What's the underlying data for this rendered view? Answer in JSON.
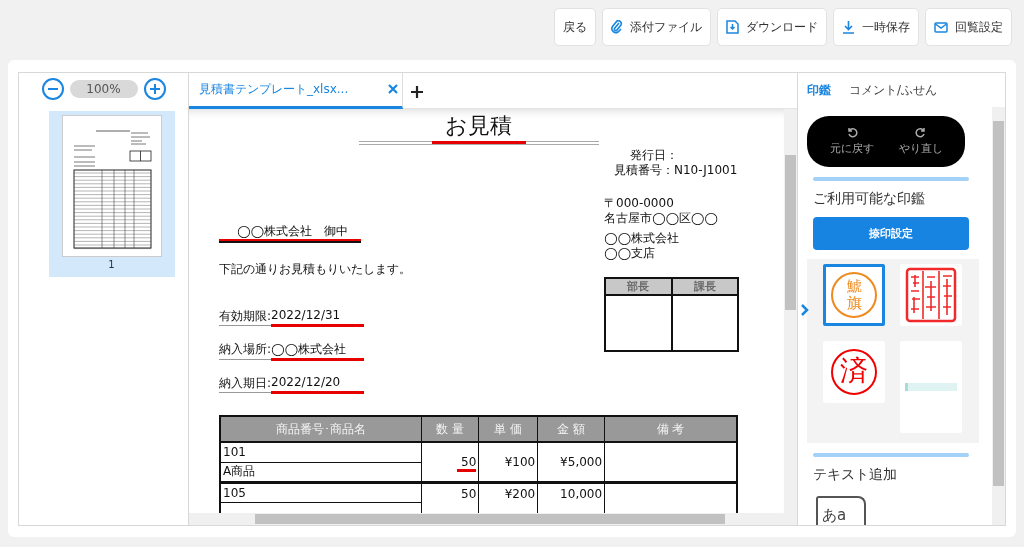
{
  "toolbar": [
    {
      "kind": "plain",
      "label": "戻る"
    },
    {
      "kind": "clip",
      "label": "添付ファイル"
    },
    {
      "kind": "file-download",
      "label": "ダウンロード"
    },
    {
      "kind": "download",
      "label": "一時保存"
    },
    {
      "kind": "mail",
      "label": "回覧設定"
    }
  ],
  "thumbnails": {
    "zoom": "100%",
    "pages": [
      {
        "label": "1",
        "selected": true
      }
    ]
  },
  "document_tabs": [
    {
      "label": "見積書テンプレート_xlsx...",
      "selected": true
    }
  ],
  "document": {
    "title": "お見積",
    "title_marked": true,
    "issue_date": "発行日：",
    "quote_number": "見積番号：N10-J1001",
    "sender": [
      "〒000-0000",
      "名古屋市◯◯区◯◯",
      "◯◯株式会社",
      "◯◯支店"
    ],
    "approval": [
      "部長",
      "課長"
    ],
    "addressee": "◯◯株式会社　御中",
    "addressee_marked": true,
    "greeting": "下記の通りお見積もりいたします。",
    "fields": [
      {
        "label": "有効期限:",
        "value": "2022/12/31",
        "marked": true
      },
      {
        "label": "納入場所:",
        "value": "◯◯株式会社",
        "marked": true
      },
      {
        "label": "納入期日:",
        "value": "2022/12/20",
        "marked": true
      }
    ],
    "table": {
      "columns": [
        "商品番号･商品名",
        "数 量",
        "単 価",
        "金 額",
        "備 考"
      ],
      "rows": [
        {
          "code": "101",
          "name": "A商品",
          "quantity": "50",
          "price": "¥100",
          "amount": "¥5,000",
          "marked": true
        },
        {
          "code": "105",
          "name": "",
          "quantity": "50",
          "price": "¥200",
          "amount": "10,000",
          "marked": false
        }
      ]
    }
  },
  "side_panel": {
    "tabs": [
      {
        "label": "印鑑",
        "selected": true
      },
      {
        "label": "コメント/ふせん",
        "selected": false
      }
    ],
    "undo": "元に戻す",
    "redo": "やり直し",
    "stamps_heading": "ご利用可能な印鑑",
    "stamp_button": "捺印設定",
    "stamps": [
      {
        "kind": "round",
        "text": "鯱旗",
        "color": "#ee8a1e",
        "selected": true
      },
      {
        "kind": "square",
        "color": "#f02a2a",
        "selected": false
      },
      {
        "kind": "round",
        "text": "済",
        "color": "#f00000",
        "selected": false
      },
      {
        "kind": "note",
        "selected": false
      }
    ],
    "text_heading": "テキスト追加",
    "text_tool": "あa"
  }
}
